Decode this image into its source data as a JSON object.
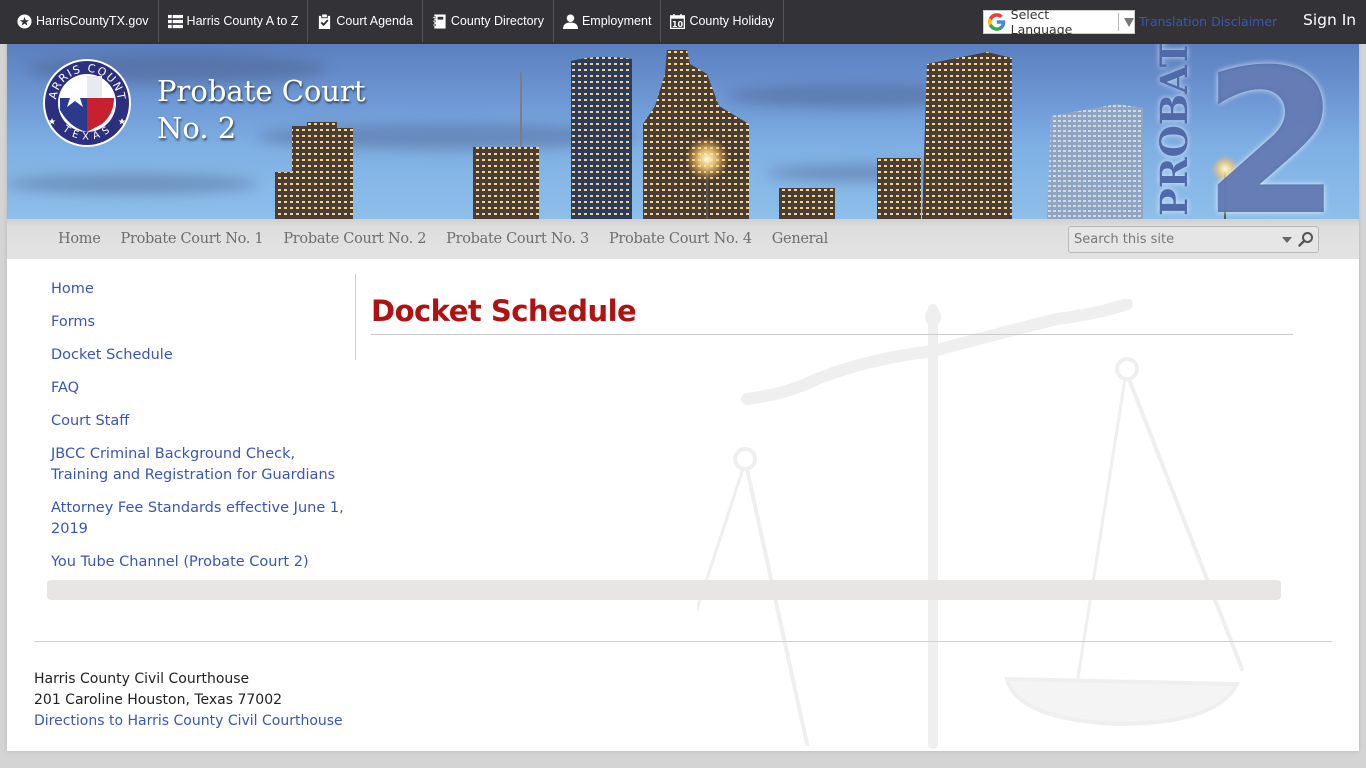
{
  "topbar": {
    "links": [
      {
        "label": "HarrisCountyTX.gov",
        "icon": "star-circle-icon"
      },
      {
        "label": "Harris County A to Z",
        "icon": "list-icon"
      },
      {
        "label": "Court Agenda",
        "icon": "clipboard-check-icon"
      },
      {
        "label": "County Directory",
        "icon": "address-book-icon"
      },
      {
        "label": "Employment",
        "icon": "person-icon"
      },
      {
        "label": "County Holiday",
        "icon": "calendar-icon"
      }
    ],
    "calendar_day": "10",
    "language_select": "Select Language",
    "translation_disclaimer": "Translation Disclaimer",
    "sign_in": "Sign In"
  },
  "banner": {
    "site_title_line1": "Probate Court",
    "site_title_line2": "No. 2",
    "logo_top_text": "HARRIS COUNTY",
    "logo_bottom_text": "TEXAS",
    "side_text": "PROBATE",
    "side_number": "2"
  },
  "nav": {
    "items": [
      "Home",
      "Probate Court No. 1",
      "Probate Court No. 2",
      "Probate Court No. 3",
      "Probate Court No. 4",
      "General"
    ],
    "search_placeholder": "Search this site"
  },
  "leftnav": {
    "items": [
      "Home",
      "Forms",
      "Docket Schedule",
      "FAQ",
      "Court Staff",
      "JBCC Criminal Background Check, Training and Registration for Guardians",
      "Attorney Fee Standards effective June 1, 2019",
      "You Tube Channel (Probate Court 2)"
    ]
  },
  "main": {
    "title": "Docket Schedule"
  },
  "footer": {
    "line1": "Harris County Civil Courthouse",
    "line2": "201 Caroline Houston, Texas 77002",
    "directions_link": "Directions to Harris County Civil Courthouse"
  },
  "colors": {
    "topbar_bg": "#333237",
    "link_blue": "#3a56b3",
    "title_red": "#b01111",
    "nav_text": "#6e6e6e"
  }
}
